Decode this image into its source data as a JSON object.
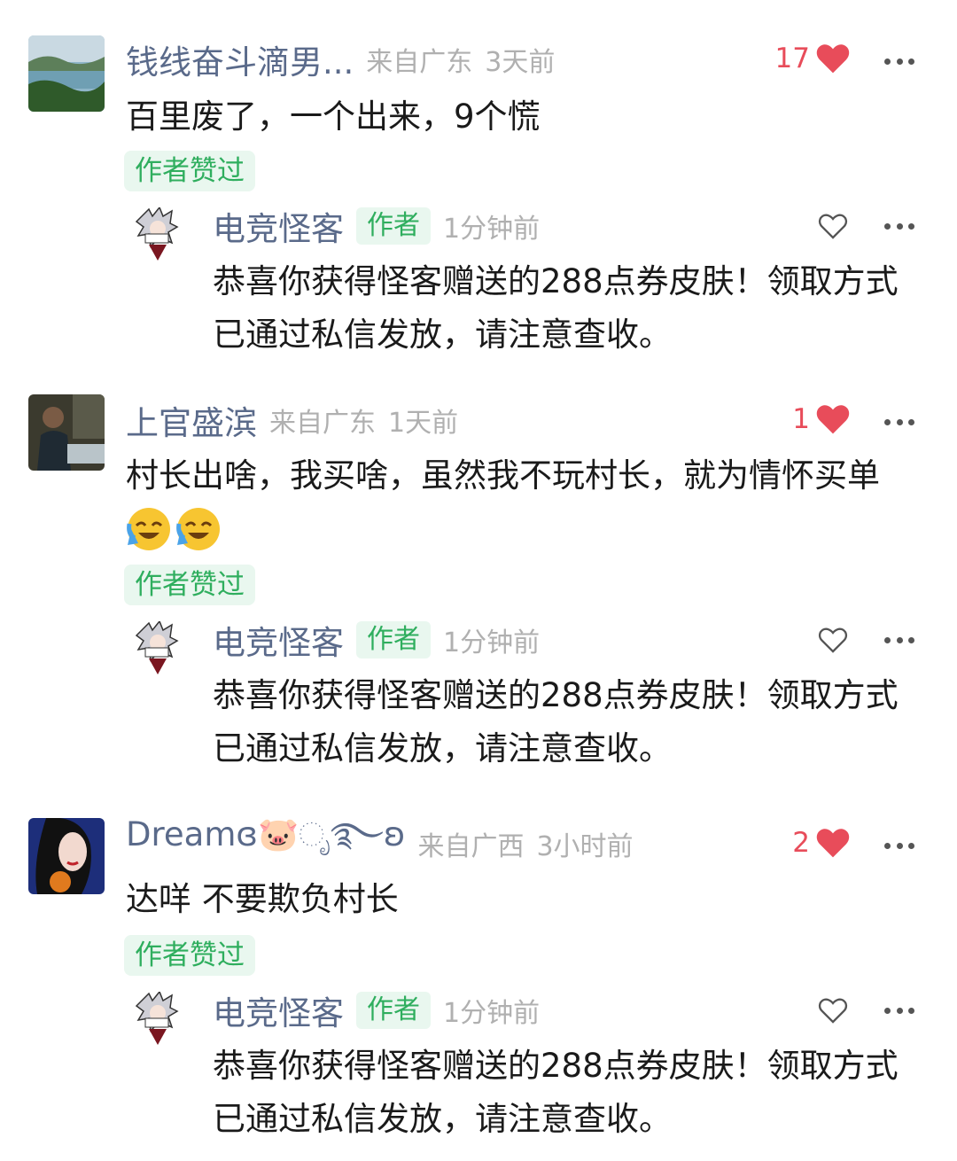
{
  "comments": [
    {
      "username": "钱线奋斗滴男...",
      "location": "来自广东",
      "time": "3天前",
      "likes": "17",
      "text": "百里废了，一个出来，9个慌",
      "liked_badge": "作者赞过",
      "reply": {
        "username": "电竞怪客",
        "author_tag": "作者",
        "time": "1分钟前",
        "text": "恭喜你获得怪客赠送的288点券皮肤！领取方式已通过私信发放，请注意查收。"
      }
    },
    {
      "username": "上官盛滨",
      "location": "来自广东",
      "time": "1天前",
      "likes": "1",
      "text": "村长出啥，我买啥，虽然我不玩村长，就为情怀买单",
      "emojis": [
        "laugh-cry-emoji",
        "laugh-cry-emoji"
      ],
      "liked_badge": "作者赞过",
      "reply": {
        "username": "电竞怪客",
        "author_tag": "作者",
        "time": "1分钟前",
        "text": "恭喜你获得怪客赠送的288点券皮肤！领取方式已通过私信发放，请注意查收。"
      }
    },
    {
      "username": "Dreamɞ🐷ೃ࿐ʚ",
      "location": "来自广西",
      "time": "3小时前",
      "likes": "2",
      "text": "达咩 不要欺负村长",
      "liked_badge": "作者赞过",
      "reply": {
        "username": "电竞怪客",
        "author_tag": "作者",
        "time": "1分钟前",
        "text": "恭喜你获得怪客赠送的288点券皮肤！领取方式已通过私信发放，请注意查收。"
      }
    }
  ],
  "colors": {
    "username": "#5a6a8a",
    "like_red": "#e84c5a",
    "badge_green": "#2fae5e",
    "badge_bg": "#e9f7ef",
    "meta_gray": "#b0b0b0"
  }
}
